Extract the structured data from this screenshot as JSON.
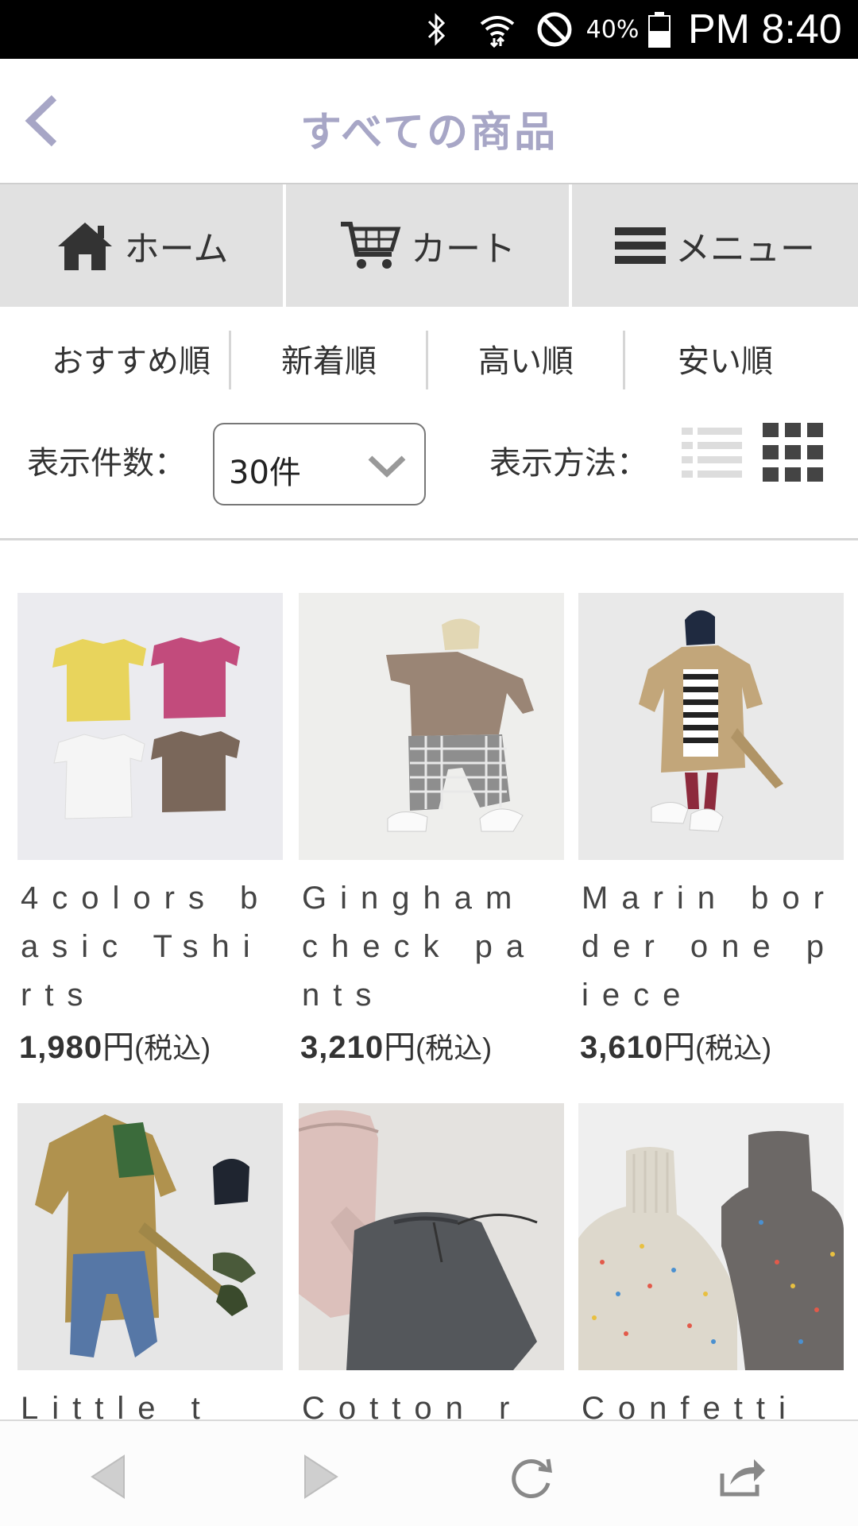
{
  "status_bar": {
    "battery_percent": "40%",
    "time": "PM 8:40",
    "icons": [
      "bluetooth-icon",
      "wifi-icon",
      "do-not-disturb-icon",
      "battery-icon"
    ]
  },
  "header": {
    "title": "すべての商品",
    "back_icon": "chevron-left-icon"
  },
  "nav": {
    "home": "ホーム",
    "cart": "カート",
    "menu": "メニュー"
  },
  "sort": {
    "tabs": [
      "おすすめ順",
      "新着順",
      "高い順",
      "安い順"
    ]
  },
  "display": {
    "count_label": "表示件数：",
    "count_value": "30件",
    "method_label": "表示方法：",
    "modes": [
      "list-view-icon",
      "grid-view-icon"
    ]
  },
  "products": [
    {
      "name": "4colors basic Tshirts",
      "price": "1,980",
      "currency": "円",
      "tax": "(税込)"
    },
    {
      "name": "Gingham check pants",
      "price": "3,210",
      "currency": "円",
      "tax": "(税込)"
    },
    {
      "name": "Marin border one piece",
      "price": "3,610",
      "currency": "円",
      "tax": "(税込)"
    },
    {
      "name": "Little t",
      "price": "",
      "currency": "",
      "tax": ""
    },
    {
      "name": "Cotton r",
      "price": "",
      "currency": "",
      "tax": ""
    },
    {
      "name": "Confetti",
      "price": "",
      "currency": "",
      "tax": ""
    }
  ],
  "browser_bar": {
    "icons": [
      "back-arrow-icon",
      "forward-arrow-icon",
      "reload-icon",
      "share-icon"
    ]
  },
  "colors": {
    "title": "#a7a6c6",
    "nav_bg": "#e1e1e1",
    "status_bg": "#000000"
  }
}
